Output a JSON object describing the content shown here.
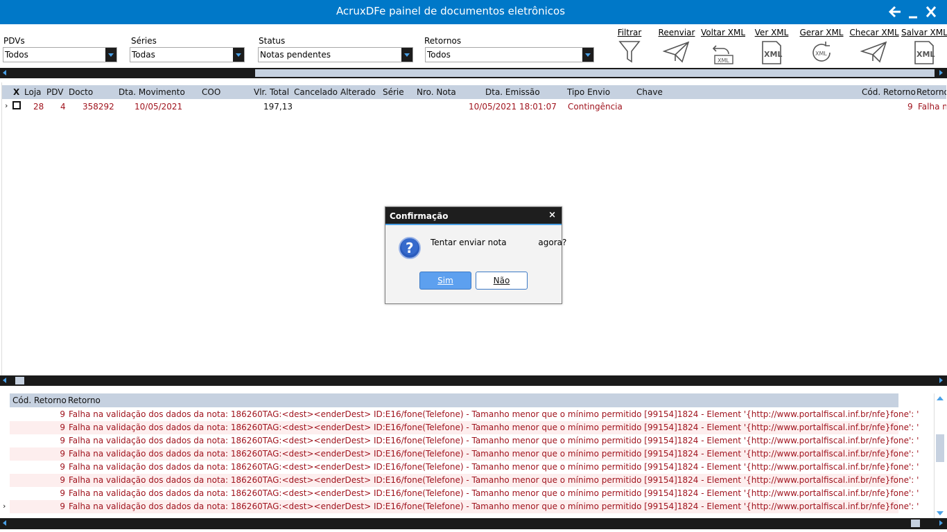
{
  "window": {
    "title": "AcruxDFe painel de documentos eletrônicos"
  },
  "filters": {
    "pdvs": {
      "label": "PDVs",
      "value": "Todos"
    },
    "series": {
      "label": "Séries",
      "value": "Todas"
    },
    "status": {
      "label": "Status",
      "value": "Notas pendentes"
    },
    "retornos": {
      "label": "Retornos",
      "value": "Todos"
    }
  },
  "toolbar": {
    "filtrar": "Filtrar",
    "reenviar": "Reenviar",
    "voltar_xml": "Voltar XML",
    "ver_xml": "Ver XML",
    "gerar_xml": "Gerar XML",
    "checar_xml": "Checar XML",
    "salvar_xml": "Salvar XML"
  },
  "grid": {
    "headers": {
      "x": "X",
      "loja": "Loja",
      "pdv": "PDV",
      "docto": "Docto",
      "dta_movimento": "Dta. Movimento",
      "coo": "COO",
      "vlr_total": "Vlr. Total",
      "cancelado": "Cancelado",
      "alterado": "Alterado",
      "serie": "Série",
      "nro_nota": "Nro. Nota",
      "dta_emissao": "Dta. Emissão",
      "tipo_envio": "Tipo Envio",
      "chave": "Chave",
      "cod_retorno": "Cód. Retorno",
      "retorno": "Retorno"
    },
    "rows": [
      {
        "loja": "28",
        "pdv": "4",
        "docto": "358292",
        "dta_movimento": "10/05/2021",
        "vlr_total": "197,13",
        "dta_emissao": "10/05/2021 18:01:07",
        "tipo_envio": "Contingência",
        "cod_retorno": "9",
        "retorno": "Falha n"
      }
    ]
  },
  "returns": {
    "headers": {
      "cod_retorno": "Cód. Retorno",
      "retorno": "Retorno"
    },
    "rows": [
      {
        "code": "9",
        "message": "Falha na validação dos dados da nota: 186260TAG:<dest><enderDest> ID:E16/fone(Telefone) - Tamanho menor que o mínimo permitido [99154]1824 - Element '{http://www.portalfiscal.inf.br/nfe}fone': '"
      },
      {
        "code": "9",
        "message": "Falha na validação dos dados da nota: 186260TAG:<dest><enderDest> ID:E16/fone(Telefone) - Tamanho menor que o mínimo permitido [99154]1824 - Element '{http://www.portalfiscal.inf.br/nfe}fone': '"
      },
      {
        "code": "9",
        "message": "Falha na validação dos dados da nota: 186260TAG:<dest><enderDest> ID:E16/fone(Telefone) - Tamanho menor que o mínimo permitido [99154]1824 - Element '{http://www.portalfiscal.inf.br/nfe}fone': '"
      },
      {
        "code": "9",
        "message": "Falha na validação dos dados da nota: 186260TAG:<dest><enderDest> ID:E16/fone(Telefone) - Tamanho menor que o mínimo permitido [99154]1824 - Element '{http://www.portalfiscal.inf.br/nfe}fone': '"
      },
      {
        "code": "9",
        "message": "Falha na validação dos dados da nota: 186260TAG:<dest><enderDest> ID:E16/fone(Telefone) - Tamanho menor que o mínimo permitido [99154]1824 - Element '{http://www.portalfiscal.inf.br/nfe}fone': '"
      },
      {
        "code": "9",
        "message": "Falha na validação dos dados da nota: 186260TAG:<dest><enderDest> ID:E16/fone(Telefone) - Tamanho menor que o mínimo permitido [99154]1824 - Element '{http://www.portalfiscal.inf.br/nfe}fone': '"
      },
      {
        "code": "9",
        "message": "Falha na validação dos dados da nota: 186260TAG:<dest><enderDest> ID:E16/fone(Telefone) - Tamanho menor que o mínimo permitido [99154]1824 - Element '{http://www.portalfiscal.inf.br/nfe}fone': '"
      },
      {
        "code": "9",
        "message": "Falha na validação dos dados da nota: 186260TAG:<dest><enderDest> ID:E16/fone(Telefone) - Tamanho menor que o mínimo permitido [99154]1824 - Element '{http://www.portalfiscal.inf.br/nfe}fone': '"
      }
    ]
  },
  "dialog": {
    "title": "Confirmação",
    "close": "×",
    "message": "Tentar enviar nota            agora?",
    "yes": "Sim",
    "no": "Não"
  },
  "icons": {
    "back": "arrow-left-icon",
    "minimize": "minimize-icon",
    "close": "close-icon",
    "filter": "funnel-icon",
    "send": "paper-plane-icon",
    "xml": "xml-file-icon",
    "question": "question-icon"
  },
  "colors": {
    "titlebar": "#0078c8",
    "header_bg": "#c6d1e0",
    "error_text": "#a0141e",
    "accent": "#4aa0e6",
    "alt_row": "#fdeeee"
  }
}
